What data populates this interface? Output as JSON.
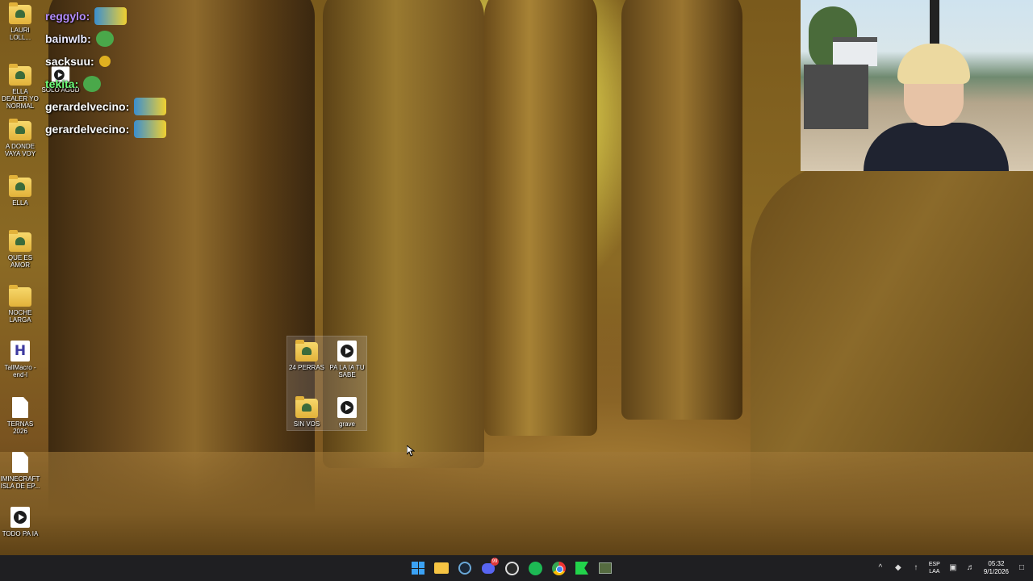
{
  "chat": [
    {
      "user": "reggylo:",
      "emote": "streamer-emote"
    },
    {
      "user": "bainwlb:",
      "emote": "frog-emote"
    },
    {
      "user": "sacksuu:",
      "emote": "coin-emote"
    },
    {
      "user": "tekita:",
      "emote": "frog-emote"
    },
    {
      "user": "gerardelvecino:",
      "emote": "streamer-emote"
    },
    {
      "user": "gerardelvecino:",
      "emote": "streamer-emote"
    }
  ],
  "desktop_icons": [
    {
      "label": "LAURI LOLL...",
      "type": "folder"
    },
    {
      "label": "SOLO AGUD",
      "type": "video"
    },
    {
      "label": "ELLA DEALER YO NORMAL",
      "type": "folder"
    },
    {
      "label": "A DONDE VAYA VOY",
      "type": "folder"
    },
    {
      "label": "ELLA",
      "type": "folder"
    },
    {
      "label": "QUE ES AMOR",
      "type": "folder"
    },
    {
      "label": "NOCHE LARGA",
      "type": "folder"
    },
    {
      "label": "TallMacro - end-l",
      "type": "app"
    },
    {
      "label": "TERNAS 2026",
      "type": "file"
    },
    {
      "label": "IMINECRAFT ISLA DE EP...",
      "type": "file"
    },
    {
      "label": "TODO PA IA",
      "type": "video"
    }
  ],
  "selected_icons": [
    {
      "label": "24 PERRAS",
      "type": "folder"
    },
    {
      "label": "PA LA IA TU SABE",
      "type": "video"
    },
    {
      "label": "SIN VOS",
      "type": "folder"
    },
    {
      "label": "grave",
      "type": "video"
    }
  ],
  "taskbar": {
    "apps": [
      "start-icon",
      "file-explorer-icon",
      "steam-icon",
      "discord-icon",
      "obs-icon",
      "spotify-icon",
      "chrome-icon",
      "capcut-icon",
      "app-icon"
    ],
    "discord_badge": "99",
    "lang_top": "ESP",
    "lang_bottom": "LAA",
    "time": "05:32",
    "date": "9/1/2026"
  },
  "colors": {
    "taskbar": "#1f1f22",
    "accent": "#3ba2f5"
  }
}
